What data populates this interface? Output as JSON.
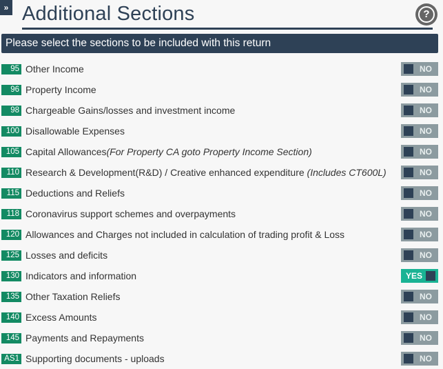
{
  "header": {
    "expand_icon": "»",
    "title": "Additional Sections",
    "help_icon": "?"
  },
  "banner": {
    "text": "Please select the sections to be included with this return"
  },
  "colors": {
    "primary": "#2e4156",
    "code_badge": "#138a63",
    "toggle_on": "#1ab394",
    "toggle_off": "#8c9ba0"
  },
  "sections": [
    {
      "code": "95",
      "label": "Other Income",
      "note": "",
      "enabled": false,
      "toggle_text": "NO"
    },
    {
      "code": "96",
      "label": "Property Income",
      "note": "",
      "enabled": false,
      "toggle_text": "NO"
    },
    {
      "code": "98",
      "label": "Chargeable Gains/losses and investment income",
      "note": "",
      "enabled": false,
      "toggle_text": "NO"
    },
    {
      "code": "100",
      "label": "Disallowable Expenses",
      "note": "",
      "enabled": false,
      "toggle_text": "NO"
    },
    {
      "code": "105",
      "label": "Capital Allowances",
      "note": "(For Property CA goto Property Income Section)",
      "enabled": false,
      "toggle_text": "NO"
    },
    {
      "code": "110",
      "label": "Research & Development(R&D) / Creative enhanced expenditure ",
      "note": "(Includes CT600L)",
      "enabled": false,
      "toggle_text": "NO"
    },
    {
      "code": "115",
      "label": "Deductions and Reliefs",
      "note": "",
      "enabled": false,
      "toggle_text": "NO"
    },
    {
      "code": "118",
      "label": "Coronavirus support schemes and overpayments",
      "note": "",
      "enabled": false,
      "toggle_text": "NO"
    },
    {
      "code": "120",
      "label": "Allowances and Charges not included in calculation of trading profit & Loss",
      "note": "",
      "enabled": false,
      "toggle_text": "NO"
    },
    {
      "code": "125",
      "label": "Losses and deficits",
      "note": "",
      "enabled": false,
      "toggle_text": "NO"
    },
    {
      "code": "130",
      "label": "Indicators and information",
      "note": "",
      "enabled": true,
      "toggle_text": "YES"
    },
    {
      "code": "135",
      "label": "Other Taxation Reliefs",
      "note": "",
      "enabled": false,
      "toggle_text": "NO"
    },
    {
      "code": "140",
      "label": "Excess Amounts",
      "note": "",
      "enabled": false,
      "toggle_text": "NO"
    },
    {
      "code": "145",
      "label": "Payments and Repayments",
      "note": "",
      "enabled": false,
      "toggle_text": "NO"
    },
    {
      "code": "AS1",
      "label": "Supporting documents - uploads",
      "note": "",
      "enabled": false,
      "toggle_text": "NO"
    }
  ]
}
